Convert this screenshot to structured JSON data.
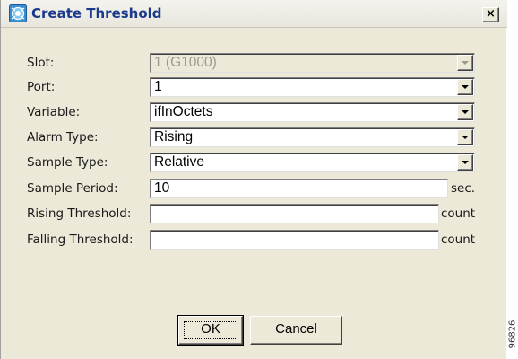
{
  "window": {
    "title": "Create Threshold",
    "close_label": "×",
    "icon": "threshold-app-icon"
  },
  "form": {
    "slot": {
      "label": "Slot:",
      "value": "1 (G1000)",
      "enabled": false
    },
    "port": {
      "label": "Port:",
      "value": "1"
    },
    "variable": {
      "label": "Variable:",
      "value": "ifInOctets"
    },
    "alarm_type": {
      "label": "Alarm Type:",
      "value": "Rising"
    },
    "sample_type": {
      "label": "Sample Type:",
      "value": "Relative"
    },
    "sample_period": {
      "label": "Sample Period:",
      "value": "10",
      "unit": "sec."
    },
    "rising_threshold": {
      "label": "Rising Threshold:",
      "value": "",
      "unit": "count"
    },
    "falling_threshold": {
      "label": "Falling Threshold:",
      "value": "",
      "unit": "count"
    }
  },
  "buttons": {
    "ok": "OK",
    "cancel": "Cancel"
  },
  "watermark": "96826",
  "colors": {
    "dialog_bg": "#ece9d8",
    "title_text": "#1b3a8c",
    "disabled_text": "#9c9a90"
  }
}
